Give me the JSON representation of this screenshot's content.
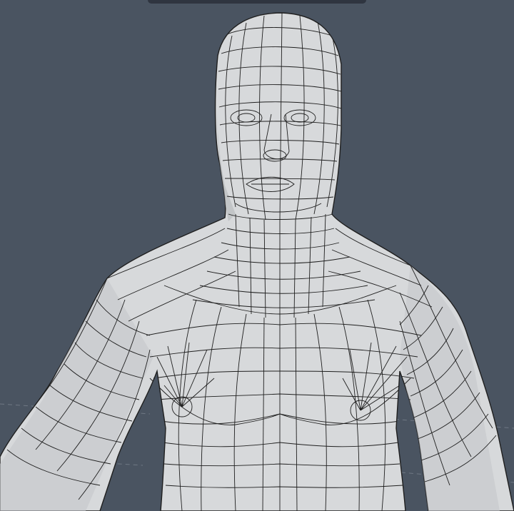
{
  "viewport": {
    "background_color": "#4a5461",
    "grid_color": "#6f7884",
    "mesh_fill": "#d7d9db",
    "mesh_shadow": "#b9bcbf",
    "mesh_wire": "#1f1f1f",
    "subject": "wireframe-human-torso-model"
  },
  "toolbar": {
    "icon": "viewport-toolbar-bar"
  }
}
